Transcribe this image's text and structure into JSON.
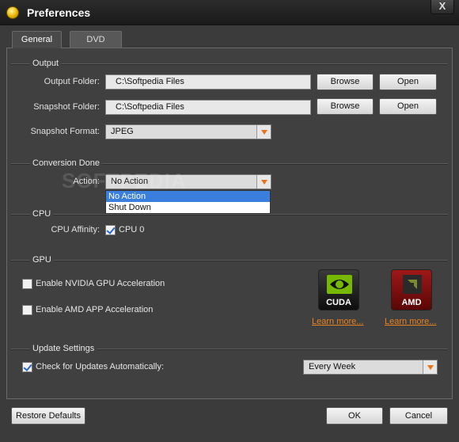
{
  "window": {
    "title": "Preferences",
    "close_glyph": "X"
  },
  "tabs": [
    {
      "label": "General",
      "active": true
    },
    {
      "label": "DVD",
      "active": false
    }
  ],
  "output": {
    "section_label": "Output",
    "output_folder_label": "Output Folder:",
    "output_folder_value": "C:\\Softpedia Files",
    "snapshot_folder_label": "Snapshot Folder:",
    "snapshot_folder_value": "C:\\Softpedia Files",
    "browse_label": "Browse",
    "open_label": "Open",
    "snapshot_format_label": "Snapshot Format:",
    "snapshot_format_value": "JPEG"
  },
  "conversion_done": {
    "section_label": "Conversion Done",
    "action_label": "Action:",
    "action_value": "No Action",
    "options": [
      "No Action",
      "Shut Down"
    ]
  },
  "cpu": {
    "section_label": "CPU",
    "affinity_label": "CPU Affinity:",
    "cpu0_label": "CPU 0",
    "cpu0_checked": true
  },
  "gpu": {
    "section_label": "GPU",
    "nvidia_label": "Enable NVIDIA GPU Acceleration",
    "nvidia_checked": false,
    "amd_label": "Enable AMD APP Acceleration",
    "amd_checked": false,
    "cuda_badge_text": "CUDA",
    "amd_badge_text": "AMD",
    "learn_more_label": "Learn more..."
  },
  "update": {
    "section_label": "Update Settings",
    "check_label": "Check for Updates Automatically:",
    "check_checked": true,
    "frequency_value": "Every Week"
  },
  "footer": {
    "restore_label": "Restore Defaults",
    "ok_label": "OK",
    "cancel_label": "Cancel"
  },
  "watermark": "SOFTPEDIA",
  "colors": {
    "accent": "#e8821e",
    "selection": "#3a7fde",
    "background": "#404040"
  }
}
